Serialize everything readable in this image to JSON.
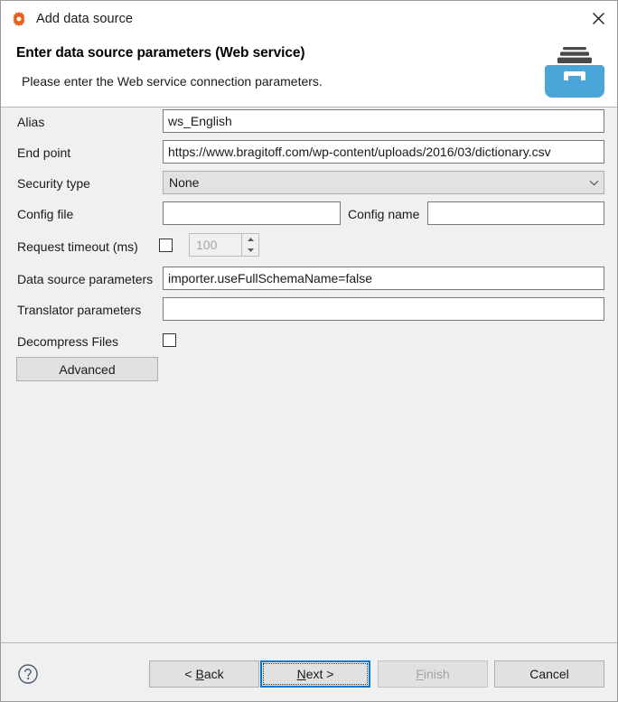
{
  "window": {
    "title": "Add data source",
    "title_icon": "gear-icon",
    "close_icon": "close-icon"
  },
  "header": {
    "title": "Enter data source parameters (Web service)",
    "description": "Please enter the Web service connection parameters.",
    "graphic_icon": "archive-box-icon",
    "graphic_color": "#4aa6d8",
    "graphic_lid_color": "#4a4a4a"
  },
  "form": {
    "alias": {
      "label": "Alias",
      "value": "ws_English",
      "placeholder": ""
    },
    "endpoint": {
      "label": "End point",
      "value": "https://www.bragitoff.com/wp-content/uploads/2016/03/dictionary.csv",
      "placeholder": ""
    },
    "security_type": {
      "label": "Security type",
      "value": "None",
      "arrow_icon": "chevron-down-icon"
    },
    "config_file": {
      "label": "Config file",
      "value": "",
      "placeholder": ""
    },
    "config_name": {
      "label": "Config name",
      "value": "",
      "placeholder": ""
    },
    "request_timeout": {
      "label": "Request timeout (ms)",
      "checked": false,
      "value": "100",
      "enabled": false
    },
    "data_source_parameters": {
      "label": "Data source parameters",
      "value": "importer.useFullSchemaName=false",
      "placeholder": ""
    },
    "translator_parameters": {
      "label": "Translator parameters",
      "value": "",
      "placeholder": ""
    },
    "decompress_files": {
      "label": "Decompress Files",
      "checked": false
    },
    "advanced_button": {
      "label": "Advanced"
    }
  },
  "footer": {
    "help_icon": "help-circle-icon",
    "back": {
      "label": "< Back",
      "mnemonic": "B",
      "before": "< ",
      "after": "ack"
    },
    "next": {
      "label": "Next >",
      "mnemonic": "N",
      "before": "",
      "after": "ext >"
    },
    "finish": {
      "label": "Finish",
      "mnemonic": "F",
      "before": "",
      "after": "inish"
    },
    "cancel": {
      "label": "Cancel"
    }
  },
  "colors": {
    "accent": "#0078d7",
    "dialog_bg": "#f0f0f0",
    "header_bg": "#ffffff",
    "title_icon": "#e8601c"
  }
}
